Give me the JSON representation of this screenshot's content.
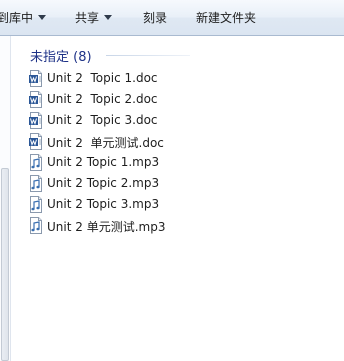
{
  "toolbar": {
    "library_label": "到库中",
    "share_label": "共享",
    "burn_label": "刻录",
    "new_folder_label": "新建文件夹"
  },
  "group": {
    "title": "未指定 (8)"
  },
  "files": [
    {
      "name": "Unit 2  Topic 1.doc",
      "type": "doc"
    },
    {
      "name": "Unit 2  Topic 2.doc",
      "type": "doc"
    },
    {
      "name": "Unit 2  Topic 3.doc",
      "type": "doc"
    },
    {
      "name": "Unit 2  单元测试.doc",
      "type": "doc"
    },
    {
      "name": "Unit 2 Topic 1.mp3",
      "type": "mp3"
    },
    {
      "name": "Unit 2 Topic 2.mp3",
      "type": "mp3"
    },
    {
      "name": "Unit 2 Topic 3.mp3",
      "type": "mp3"
    },
    {
      "name": "Unit 2 单元测试.mp3",
      "type": "mp3"
    }
  ],
  "colors": {
    "group_title": "#1e3287",
    "doc_icon": "#2b5797",
    "mp3_icon": "#3a6fb0"
  }
}
